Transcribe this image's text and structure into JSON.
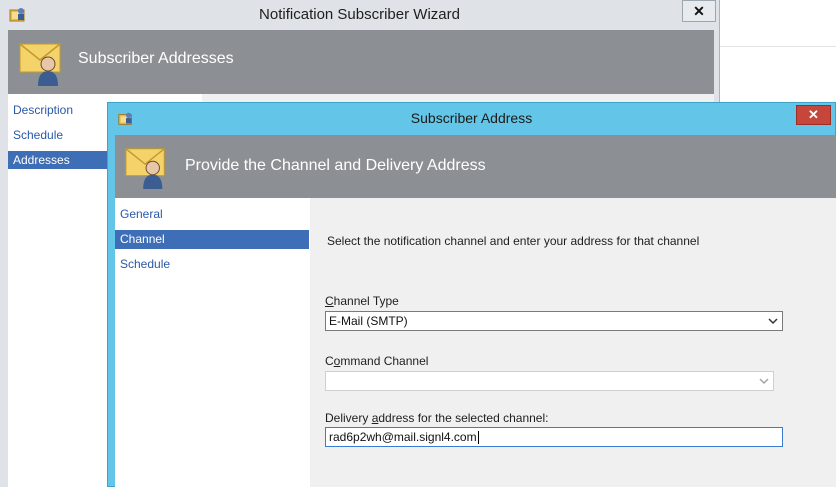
{
  "parent_window": {
    "title": "Notification Subscriber Wizard",
    "close_label": "✕",
    "header_title": "Subscriber Addresses",
    "nav": [
      {
        "label": "Description",
        "selected": false
      },
      {
        "label": "Schedule",
        "selected": false
      },
      {
        "label": "Addresses",
        "selected": true
      }
    ]
  },
  "dialog": {
    "title": "Subscriber Address",
    "close_label": "✕",
    "header_title": "Provide the Channel and Delivery Address",
    "nav": [
      {
        "label": "General",
        "selected": false
      },
      {
        "label": "Channel",
        "selected": true
      },
      {
        "label": "Schedule",
        "selected": false
      }
    ],
    "instruction": "Select the notification channel and enter your address for that channel",
    "channel_type": {
      "label_mnemonic": "C",
      "label_rest": "hannel Type",
      "value": "E-Mail (SMTP)"
    },
    "command_channel": {
      "label_pre": "C",
      "label_mnemonic": "o",
      "label_rest": "mmand Channel",
      "value": ""
    },
    "delivery_address": {
      "label_pre": "Delivery ",
      "label_mnemonic": "a",
      "label_rest": "ddress for the selected channel:",
      "value": "rad6p2wh@mail.signl4.com"
    }
  },
  "colors": {
    "dialog_frame": "#63c5e7",
    "header_band": "#8c9094",
    "nav_selected": "#3e6eb5",
    "close_button": "#c7463b"
  },
  "icons": {
    "parent_app_icon": "wizard-app-icon",
    "parent_header_icon": "envelope-person-icon",
    "dialog_app_icon": "wizard-app-icon",
    "dialog_header_icon": "envelope-person-icon",
    "dropdown_chevron": "chevron-down-icon"
  }
}
